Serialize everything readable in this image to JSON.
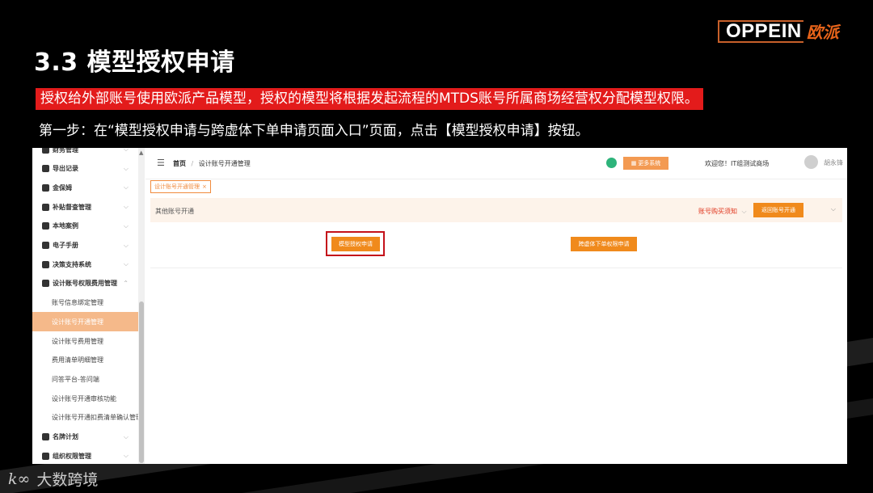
{
  "slide": {
    "title": "3.3 模型授权申请",
    "brand_en": "OPPEIN",
    "brand_cn": "欧派",
    "highlight_text": "授权给外部账号使用欧派产品模型，授权的模型将根据发起流程的MTDS账号所属商场经营权分配模型权限。",
    "step_text": "第一步：在“模型授权申请与跨虚体下单申请页面入口”页面，点击【模型授权申请】按钮。",
    "footer_text": "大数跨境",
    "accent_color": "#e31b1b",
    "brand_color": "#e8641a"
  },
  "app": {
    "sidebar": {
      "items": [
        {
          "label": "财务管理",
          "icon": "finance-icon"
        },
        {
          "label": "导出记录",
          "icon": "export-icon"
        },
        {
          "label": "金保姆",
          "icon": "gear-icon"
        },
        {
          "label": "补贴督查管理",
          "icon": "doc-icon"
        },
        {
          "label": "本地案例",
          "icon": "gear-icon"
        },
        {
          "label": "电子手册",
          "icon": "gear-icon"
        },
        {
          "label": "决策支持系统",
          "icon": "gear-icon"
        },
        {
          "label": "设计账号权限费用管理",
          "icon": "gear-icon"
        },
        {
          "label": "名牌计划",
          "icon": "people-icon"
        },
        {
          "label": "组织权限管理",
          "icon": "people-icon"
        }
      ],
      "subitems": [
        {
          "label": "账号信息绑定管理"
        },
        {
          "label": "设计账号开通管理",
          "active": true
        },
        {
          "label": "设计账号费用管理"
        },
        {
          "label": "费用清单明细管理"
        },
        {
          "label": "问答平台-答问端"
        },
        {
          "label": "设计账号开通审核功能"
        },
        {
          "label": "设计账号开通扣费清单确认管理"
        }
      ]
    },
    "header": {
      "breadcrumb_home": "首页",
      "breadcrumb_sep": "/",
      "breadcrumb_current": "设计账号开通管理",
      "more_systems": "更多系统",
      "welcome": "欢迎您！IT组测试商场",
      "user_name": "胡永锋"
    },
    "tab": {
      "label": "设计账号开通管理",
      "close": "×"
    },
    "panel": {
      "title": "其他账号开通",
      "notice": "账号购买须知",
      "back_button": "返回账号开通"
    },
    "buttons": {
      "model_auth": "模型授权申请",
      "cross_order": "跨虚体下单权限申请"
    }
  }
}
